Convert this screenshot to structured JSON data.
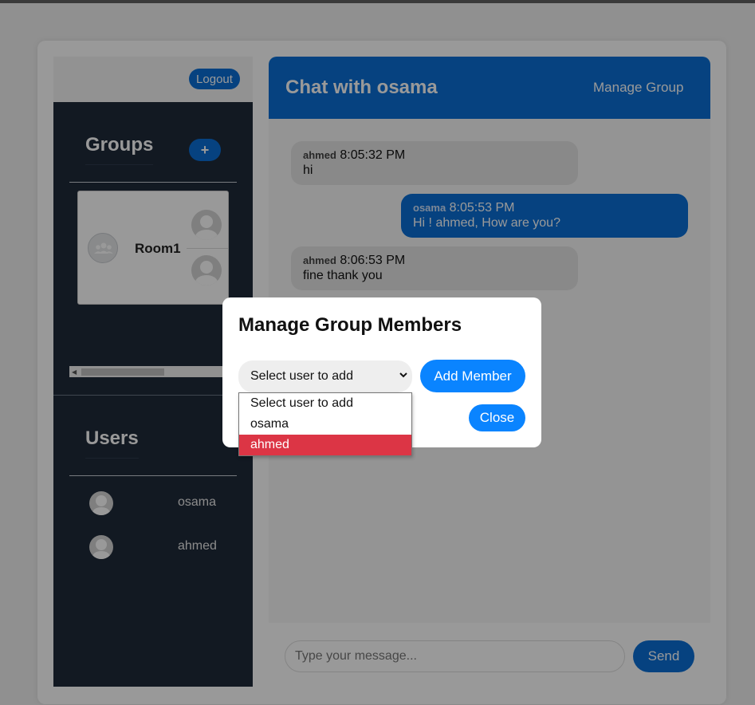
{
  "sidebar": {
    "logout_label": "Logout",
    "groups_title": "Groups",
    "add_group_label": "+",
    "groups": [
      {
        "name": "Room1",
        "member_labels": [
          "o",
          "a"
        ]
      }
    ],
    "users_title": "Users",
    "users": [
      {
        "name": "osama"
      },
      {
        "name": "ahmed"
      }
    ]
  },
  "chat": {
    "title": "Chat with osama",
    "manage_group_label": "Manage Group",
    "messages": [
      {
        "sender": "ahmed",
        "time": "8:05:32 PM",
        "text": "hi",
        "direction": "in"
      },
      {
        "sender": "osama",
        "time": "8:05:53 PM",
        "text": "Hi ! ahmed, How are you?",
        "direction": "out"
      },
      {
        "sender": "ahmed",
        "time": "8:06:53 PM",
        "text": "fine thank you",
        "direction": "in"
      }
    ],
    "input_placeholder": "Type your message...",
    "send_label": "Send"
  },
  "modal": {
    "title": "Manage Group Members",
    "select_value": "Select user to add",
    "add_member_label": "Add Member",
    "close_label": "Close",
    "options": [
      {
        "label": "Select user to add",
        "highlighted": false
      },
      {
        "label": "osama",
        "highlighted": false
      },
      {
        "label": "ahmed",
        "highlighted": true
      }
    ]
  },
  "colors": {
    "primary": "#0a6fd6",
    "sidebar_bg": "#1f2a3a",
    "option_highlight": "#dc3545",
    "modal_button": "#0a84ff"
  },
  "icons": {
    "group_avatar": "group-icon",
    "user_avatar": "user-avatar-icon",
    "select_chevron": "chevron-down-icon"
  }
}
